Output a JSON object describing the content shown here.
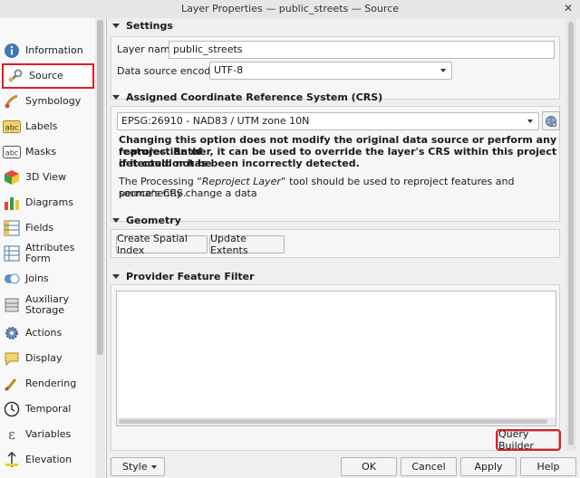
{
  "window": {
    "title": "Layer Properties — public_streets — Source",
    "close_glyph": "✕"
  },
  "sidebar": {
    "items": [
      {
        "label": "Information",
        "icon": "info-icon"
      },
      {
        "label": "Source",
        "icon": "source-wrench-icon",
        "selected": true
      },
      {
        "label": "Symbology",
        "icon": "symbology-brush-icon"
      },
      {
        "label": "Labels",
        "icon": "labels-abc-icon"
      },
      {
        "label": "Masks",
        "icon": "masks-abc-icon"
      },
      {
        "label": "3D View",
        "icon": "cube-icon"
      },
      {
        "label": "Diagrams",
        "icon": "diagrams-icon"
      },
      {
        "label": "Fields",
        "icon": "fields-icon"
      },
      {
        "label": "Attributes Form",
        "icon": "attributes-form-icon"
      },
      {
        "label": "Joins",
        "icon": "joins-icon"
      },
      {
        "label": "Auxiliary\nStorage",
        "icon": "auxiliary-storage-icon"
      },
      {
        "label": "Actions",
        "icon": "actions-gear-icon"
      },
      {
        "label": "Display",
        "icon": "display-speech-icon"
      },
      {
        "label": "Rendering",
        "icon": "rendering-brush-icon"
      },
      {
        "label": "Temporal",
        "icon": "clock-icon"
      },
      {
        "label": "Variables",
        "icon": "variables-epsilon-icon"
      },
      {
        "label": "Elevation",
        "icon": "elevation-icon"
      }
    ]
  },
  "settings": {
    "header": "Settings",
    "layer_name_label": "Layer name",
    "layer_name_value": "public_streets",
    "encoding_label": "Data source encoding",
    "encoding_value": "UTF-8"
  },
  "crs": {
    "header": "Assigned Coordinate Reference System (CRS)",
    "value": "EPSG:26910 - NAD83 / UTM zone 10N",
    "warning_line1": "Changing this option does not modify the original data source or perform any reprojection of",
    "warning_line2": "features. Rather, it can be used to override the layer's CRS within this project if it could not be",
    "warning_line3": "detected or has been incorrectly detected.",
    "info_line1_pre": "The Processing “",
    "info_line1_em": "Reproject Layer",
    "info_line1_post": "” tool should be used to reproject features and permanently change a data",
    "info_line2": "source's CRS."
  },
  "geometry": {
    "header": "Geometry",
    "create_index": "Create Spatial Index",
    "update_extents": "Update Extents"
  },
  "filter": {
    "header": "Provider Feature Filter",
    "text": "",
    "query_builder": "Query Builder"
  },
  "bottom": {
    "style": "Style",
    "ok": "OK",
    "cancel": "Cancel",
    "apply": "Apply",
    "help": "Help"
  }
}
